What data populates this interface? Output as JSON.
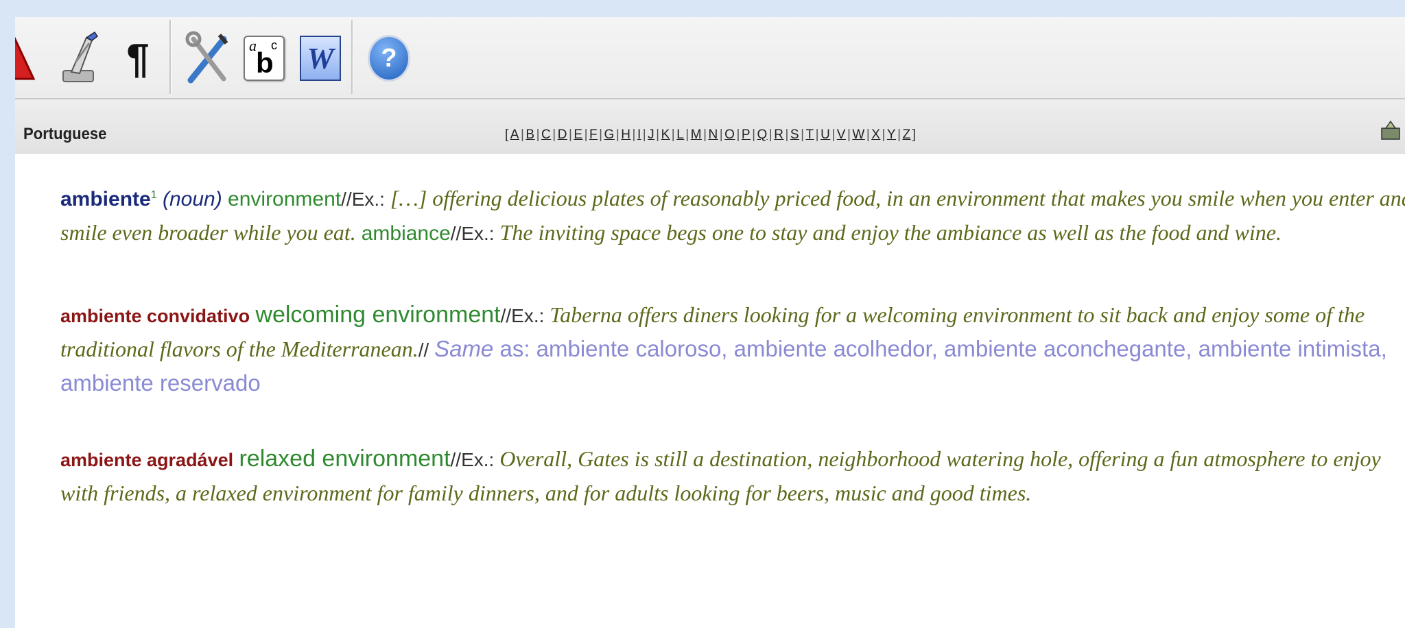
{
  "toolbar": {
    "buttons": [
      {
        "name": "warning-icon"
      },
      {
        "name": "paint-brush-icon"
      },
      {
        "name": "pilcrow-icon",
        "glyph": "¶"
      },
      {
        "name": "tools-icon"
      },
      {
        "name": "abc-icon",
        "a": "a",
        "b": "b",
        "c": "c"
      },
      {
        "name": "word-icon",
        "glyph": "W"
      },
      {
        "name": "help-icon",
        "glyph": "?"
      }
    ]
  },
  "index_bar": {
    "language": "Portuguese",
    "letters": [
      "A",
      "B",
      "C",
      "D",
      "E",
      "F",
      "G",
      "H",
      "I",
      "J",
      "K",
      "L",
      "M",
      "N",
      "O",
      "P",
      "Q",
      "R",
      "S",
      "T",
      "U",
      "V",
      "W",
      "X",
      "Y",
      "Z"
    ]
  },
  "entries": [
    {
      "headword": "ambiente",
      "sense": "1",
      "pos": "(noun)",
      "translation1": "environment",
      "sep": "//",
      "ex_label": "Ex.:",
      "example1": " […] offering delicious plates of reasonably priced food, in an environment that makes you smile when you enter and smile even broader while you eat. ",
      "translation2": "ambiance",
      "example2": " The inviting space begs one to stay and enjoy the ambiance as well as the food and wine."
    },
    {
      "headword": "ambiente convidativo",
      "translation": "welcoming environment",
      "sep": "//",
      "ex_label": "Ex.:",
      "example": " Taberna offers diners looking for a welcoming environment to sit back and enjoy some of the traditional flavors of the Mediterranean.",
      "sep2": "// ",
      "same_label": "Same",
      "same_as": " as: ambiente caloroso, ambiente acolhedor, ambiente aconchegante, ambiente intimista, ambiente reservado"
    },
    {
      "headword": "ambiente agradável",
      "translation": "relaxed environment",
      "sep": "//",
      "ex_label": "Ex.:",
      "example": " Overall, Gates is still a destination, neighborhood watering hole, offering a fun atmosphere to enjoy with friends, a relaxed environment for family dinners, and for adults looking for beers, music and good times."
    }
  ]
}
